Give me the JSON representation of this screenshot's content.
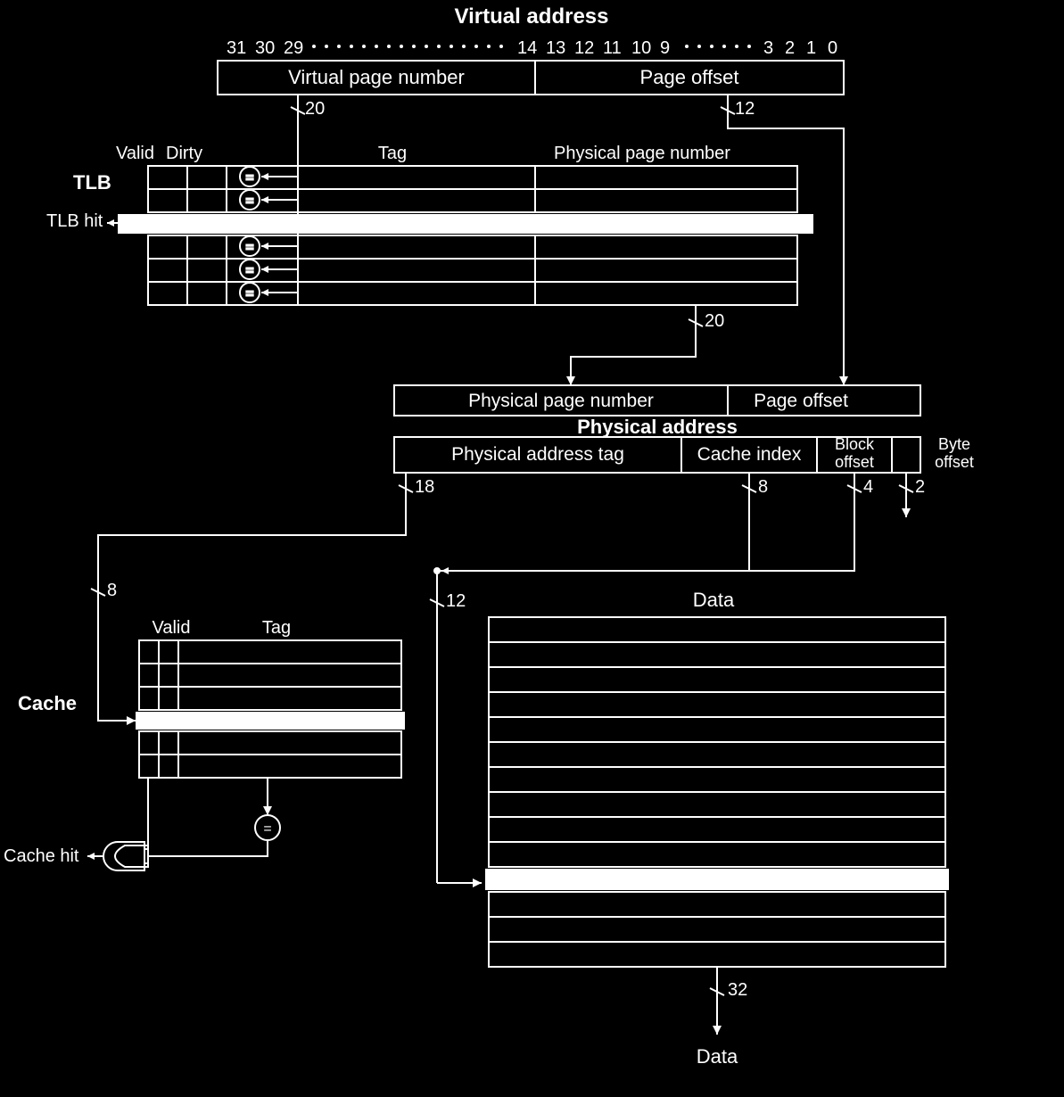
{
  "title": "Virtual address",
  "bit_numbers_va": [
    "31",
    "30",
    "29",
    "14",
    "13",
    "12",
    "11",
    "10",
    "9",
    "3",
    "2",
    "1",
    "0"
  ],
  "va_fields": {
    "vpn": "Virtual page number",
    "offset": "Page offset"
  },
  "widths": {
    "vpn": "20",
    "offset": "12",
    "ppn": "20",
    "pa_tag": "18",
    "cache_index": "8",
    "block_offset": "4",
    "byte_offset": "2",
    "data": "32",
    "cache_ref": "12",
    "to_cache": "8"
  },
  "tlb": {
    "label": "TLB",
    "hit_label": "TLB hit",
    "cols": {
      "valid": "Valid",
      "dirty": "Dirty",
      "tag": "Tag",
      "ppn": "Physical page number"
    }
  },
  "pa": {
    "title": "Physical address",
    "ppn": "Physical page number",
    "offset": "Page offset",
    "tag": "Physical address tag",
    "index": "Cache index",
    "block": "Block\noffset",
    "byte": "Byte\noffset"
  },
  "cache": {
    "label": "Cache",
    "hit_label": "Cache hit",
    "valid": "Valid",
    "tag": "Tag",
    "data": "Data"
  },
  "data_out": "Data",
  "eq": "="
}
